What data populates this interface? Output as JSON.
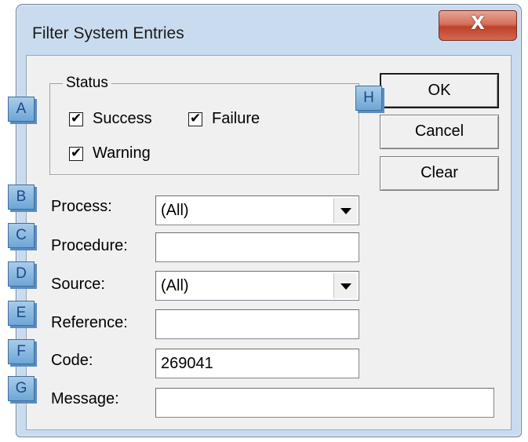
{
  "window": {
    "title": "Filter System Entries",
    "close_glyph": "X"
  },
  "status_group": {
    "legend": "Status",
    "checkboxes": [
      {
        "label": "Success",
        "checked": true
      },
      {
        "label": "Failure",
        "checked": true
      },
      {
        "label": "Warning",
        "checked": true
      }
    ],
    "check_glyph": "✔"
  },
  "buttons": {
    "ok": "OK",
    "cancel": "Cancel",
    "clear": "Clear"
  },
  "fields": [
    {
      "label": "Process:",
      "value": "(All)",
      "type": "dropdown"
    },
    {
      "label": "Procedure:",
      "value": "",
      "type": "text"
    },
    {
      "label": "Source:",
      "value": "(All)",
      "type": "dropdown"
    },
    {
      "label": "Reference:",
      "value": "",
      "type": "text"
    },
    {
      "label": "Code:",
      "value": "269041",
      "type": "text"
    },
    {
      "label": "Message:",
      "value": "",
      "type": "text"
    }
  ],
  "callouts": [
    "A",
    "B",
    "C",
    "D",
    "E",
    "F",
    "G",
    "H"
  ],
  "colors": {
    "window_frame": "#c9dcef",
    "client_bg": "#f0f0f0",
    "close_button": "#c0412a",
    "callout_fill": "#8dbbe2",
    "callout_text": "#1d4a8a"
  }
}
